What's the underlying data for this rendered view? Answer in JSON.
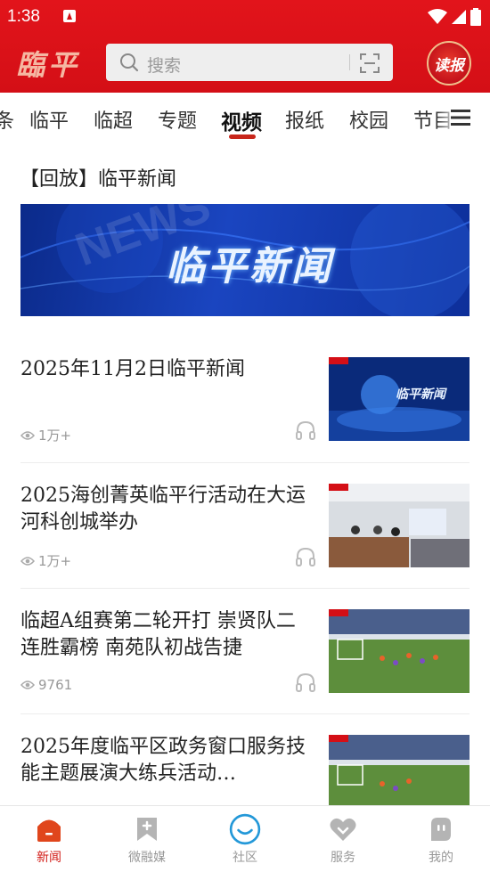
{
  "status_bar": {
    "time": "1:38"
  },
  "header": {
    "logo_text": "臨平",
    "search_placeholder": "搜索",
    "read_paper_label": "读报"
  },
  "tabs": [
    {
      "label": "条"
    },
    {
      "label": "临平"
    },
    {
      "label": "临超"
    },
    {
      "label": "专题"
    },
    {
      "label": "视频",
      "active": true
    },
    {
      "label": "报纸"
    },
    {
      "label": "校园"
    },
    {
      "label": "节目"
    }
  ],
  "replay": {
    "title": "【回放】临平新闻",
    "banner_text": "临平新闻"
  },
  "news": [
    {
      "title": "2025年11月2日临平新闻",
      "views": "1万+"
    },
    {
      "title": "2025海创菁英临平行活动在大运河科创城举办",
      "views": "1万+"
    },
    {
      "title": "临超A组赛第二轮开打  崇贤队二连胜霸榜  南苑队初战告捷",
      "views": "9761"
    },
    {
      "title": "2025年度临平区政务窗口服务技能主题展演大练兵活动…",
      "views": ""
    }
  ],
  "bottom_nav": [
    {
      "label": "新闻",
      "icon": "news-icon",
      "active": true
    },
    {
      "label": "微融媒",
      "icon": "bookmark-plus-icon"
    },
    {
      "label": "社区",
      "icon": "smile-circle-icon"
    },
    {
      "label": "服务",
      "icon": "heart-icon"
    },
    {
      "label": "我的",
      "icon": "profile-icon"
    }
  ],
  "colors": {
    "brand_red": "#d40f16",
    "active_nav": "#d21c17",
    "underline": "#c8261b"
  }
}
